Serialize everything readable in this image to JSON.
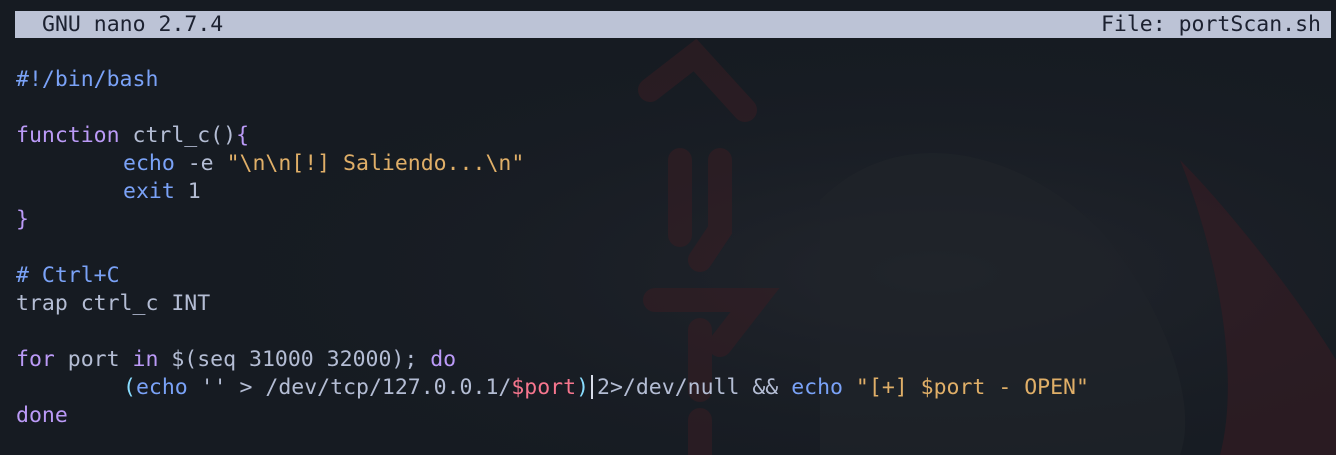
{
  "nano": {
    "version_label": "GNU nano 2.7.4",
    "file_label": "File: portScan.sh"
  },
  "code": {
    "shebang": "#!/bin/bash",
    "func_kw": "function",
    "func_name": " ctrl_c()",
    "open_brace": "{",
    "echo_cmd": "echo",
    "echo_flag": " -e ",
    "echo_str": "\"\\n\\n[!] Saliendo...\\n\"",
    "exit_kw": "exit",
    "exit_code": " 1",
    "close_brace": "}",
    "comment": "# Ctrl+C",
    "trap_line": "trap ctrl_c INT",
    "for_kw": "for",
    "for_var": " port ",
    "in_kw": "in",
    "seq_expr": " $(seq 31000 32000); ",
    "do_kw": "do",
    "open_paren": "(",
    "echo2": "echo",
    "redirect": " '' > /dev/tcp/127.0.0.1/",
    "port_var": "$port",
    "close_paren": ")",
    "null_redirect": "2>/dev/null && ",
    "echo3": "echo",
    "open_str": " \"[+] ",
    "port_var2": "$port",
    "close_str": " - OPEN\"",
    "done_kw": "done"
  },
  "colors": {
    "background": "#161b22",
    "titlebar": "#bcc3d6",
    "keyword": "#bb9af7",
    "string": "#e0af68",
    "variable": "#f7768e",
    "builtin": "#7aa2f7"
  }
}
